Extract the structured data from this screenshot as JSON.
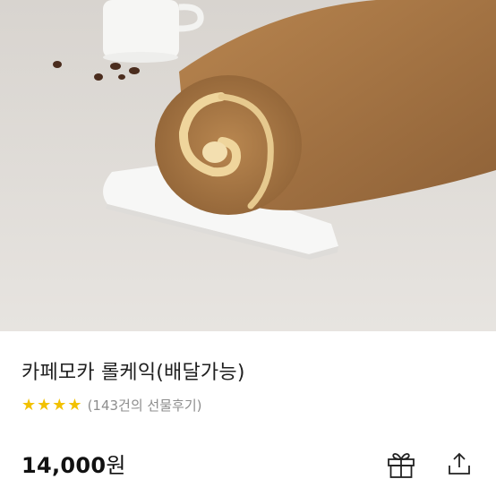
{
  "product": {
    "title": "카페모카 롤케익(배달가능)",
    "rating": 4,
    "rating_max": 4,
    "review_count_text": "(143건의 선물후기)",
    "price_amount": "14,000",
    "price_unit": "원"
  },
  "icons": {
    "star": "star-icon",
    "gift": "gift-icon",
    "share": "share-icon"
  },
  "colors": {
    "star": "#f2c100",
    "price": "#111111",
    "muted": "#8d8d8d"
  }
}
